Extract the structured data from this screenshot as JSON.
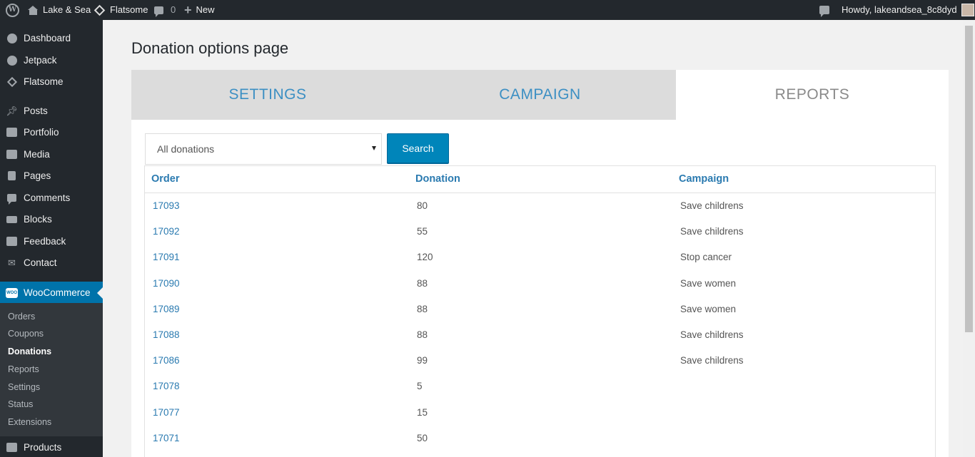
{
  "adminbar": {
    "site_name": "Lake & Sea",
    "theme_name": "Flatsome",
    "comments_count": "0",
    "new_label": "New",
    "howdy": "Howdy, lakeandsea_8c8dyd"
  },
  "sidebar": {
    "items": [
      {
        "label": "Dashboard",
        "icon": "dashboard-icon"
      },
      {
        "label": "Jetpack",
        "icon": "jetpack-icon"
      },
      {
        "label": "Flatsome",
        "icon": "flatsome-icon"
      },
      {
        "label": "Posts",
        "icon": "pin-icon"
      },
      {
        "label": "Portfolio",
        "icon": "folder-icon"
      },
      {
        "label": "Media",
        "icon": "media-icon"
      },
      {
        "label": "Pages",
        "icon": "pages-icon"
      },
      {
        "label": "Comments",
        "icon": "comment-icon"
      },
      {
        "label": "Blocks",
        "icon": "blocks-icon"
      },
      {
        "label": "Feedback",
        "icon": "feedback-icon"
      },
      {
        "label": "Contact",
        "icon": "mail-icon"
      },
      {
        "label": "WooCommerce",
        "icon": "woo-icon"
      },
      {
        "label": "Products",
        "icon": "products-icon"
      }
    ],
    "woo_icon_text": "WOO",
    "submenu": [
      "Orders",
      "Coupons",
      "Donations",
      "Reports",
      "Settings",
      "Status",
      "Extensions"
    ]
  },
  "main": {
    "title": "Donation options page",
    "tabs": [
      "SETTINGS",
      "CAMPAIGN",
      "REPORTS"
    ],
    "filter": {
      "selected": "All donations"
    },
    "search_label": "Search",
    "table": {
      "headers": [
        "Order",
        "Donation",
        "Campaign"
      ],
      "rows": [
        {
          "order": "17093",
          "donation": "80",
          "campaign": "Save childrens"
        },
        {
          "order": "17092",
          "donation": "55",
          "campaign": "Save childrens"
        },
        {
          "order": "17091",
          "donation": "120",
          "campaign": "Stop cancer"
        },
        {
          "order": "17090",
          "donation": "88",
          "campaign": "Save women"
        },
        {
          "order": "17089",
          "donation": "88",
          "campaign": "Save women"
        },
        {
          "order": "17088",
          "donation": "88",
          "campaign": "Save childrens"
        },
        {
          "order": "17086",
          "donation": "99",
          "campaign": "Save childrens"
        },
        {
          "order": "17078",
          "donation": "5",
          "campaign": ""
        },
        {
          "order": "17077",
          "donation": "15",
          "campaign": ""
        },
        {
          "order": "17071",
          "donation": "50",
          "campaign": ""
        }
      ]
    }
  },
  "colors": {
    "adminbar_bg": "#23282d",
    "active_menu": "#0073aa",
    "link": "#2a7ab0",
    "button": "#0085ba"
  }
}
